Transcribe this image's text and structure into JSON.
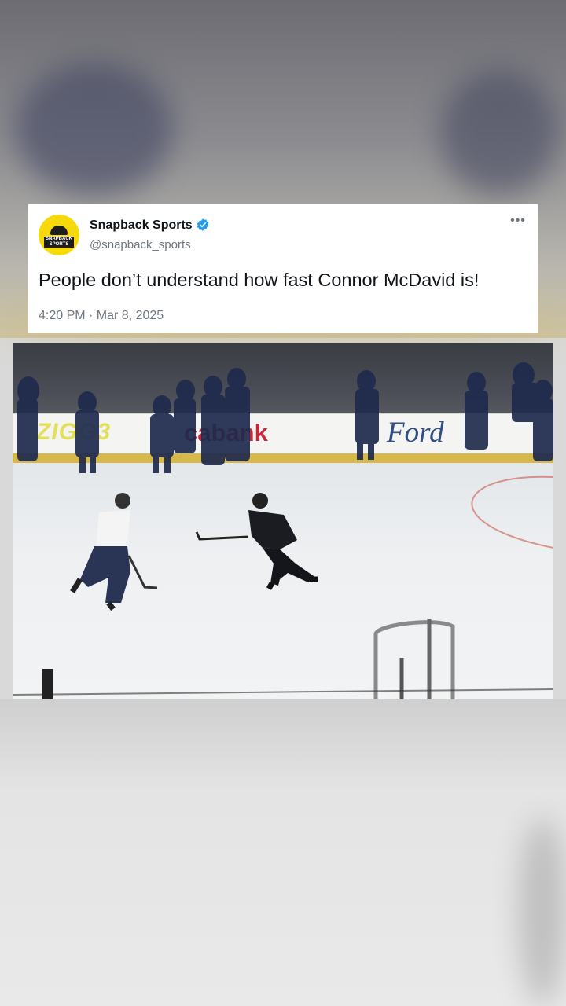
{
  "tweet": {
    "display_name": "Snapback Sports",
    "handle": "@snapback_sports",
    "text": "People don’t understand how fast Connor McDavid is!",
    "timestamp": "4:20 PM · Mar 8, 2025",
    "more_label": "•••",
    "avatar_text": "SNAPBACK SPORTS",
    "verified": true
  },
  "video": {
    "ad_left": "ZIGG3",
    "ad_bank": "cabank",
    "ad_ford": "Ford"
  },
  "colors": {
    "avatar_bg": "#f5d90a",
    "verified": "#1d9bf0",
    "card_bg": "#ffffff"
  },
  "icons": [
    "verified-badge-icon",
    "more-options-icon"
  ]
}
